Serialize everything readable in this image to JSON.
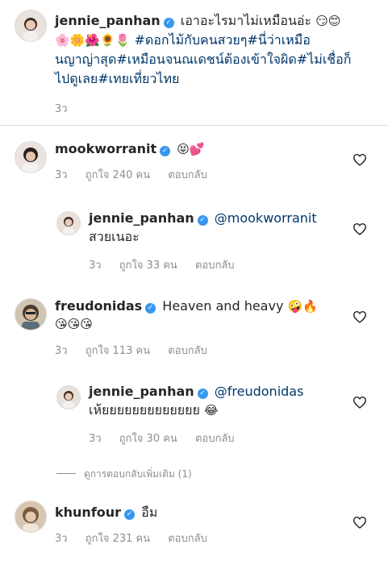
{
  "caption": {
    "username": "jennie_panhan",
    "line1": "เอาอะไรมาไม่เหมือนอ่ะ",
    "line1_emojis": "😏😊",
    "line2_emojis": "🌸🌼🌺🌻🌷",
    "line2_text": "#ดอกไม้กับคนสวยๆ#นี่ว่าเหมือ",
    "line3": "นญาญ่าสุด#เหมือนจนณเดชน์ต้องเข้าใจผิด#ไม่เชื่อก็",
    "line4": "ไปดูเลย#เทยเที่ยวไทย",
    "time": "3ว"
  },
  "comments": [
    {
      "username": "mookworranit",
      "text": "",
      "emojis": "😝💕",
      "time": "3ว",
      "likes": "ถูกใจ 240 คน",
      "reply": "ตอบกลับ"
    },
    {
      "username": "jennie_panhan",
      "mention": "@mookworranit",
      "text": "สวยเนอะ",
      "time": "3ว",
      "likes": "ถูกใจ 33 คน",
      "reply": "ตอบกลับ"
    },
    {
      "username": "freudonidas",
      "text": "Heaven and heavy",
      "emojis": "🤪🔥",
      "emojis2": "😘😘😘",
      "time": "3ว",
      "likes": "ถูกใจ 113 คน",
      "reply": "ตอบกลับ"
    },
    {
      "username": "jennie_panhan",
      "mention": "@freudonidas",
      "text": "เห้ยยยยยยยยยยยยย",
      "emojis": "😂",
      "time": "3ว",
      "likes": "ถูกใจ 30 คน",
      "reply": "ตอบกลับ"
    },
    {
      "username": "khunfour",
      "text": "อืม",
      "time": "3ว",
      "likes": "ถูกใจ 231 คน",
      "reply": "ตอบกลับ"
    }
  ],
  "view_more": "ดูการตอบกลับเพิ่มเติม (1)",
  "verified_mark": "✓",
  "heart_icon": "heart-outline",
  "colors": {
    "verified": "#3897f0",
    "secondary": "#8e8e8e",
    "divider": "#dbdbdb"
  }
}
